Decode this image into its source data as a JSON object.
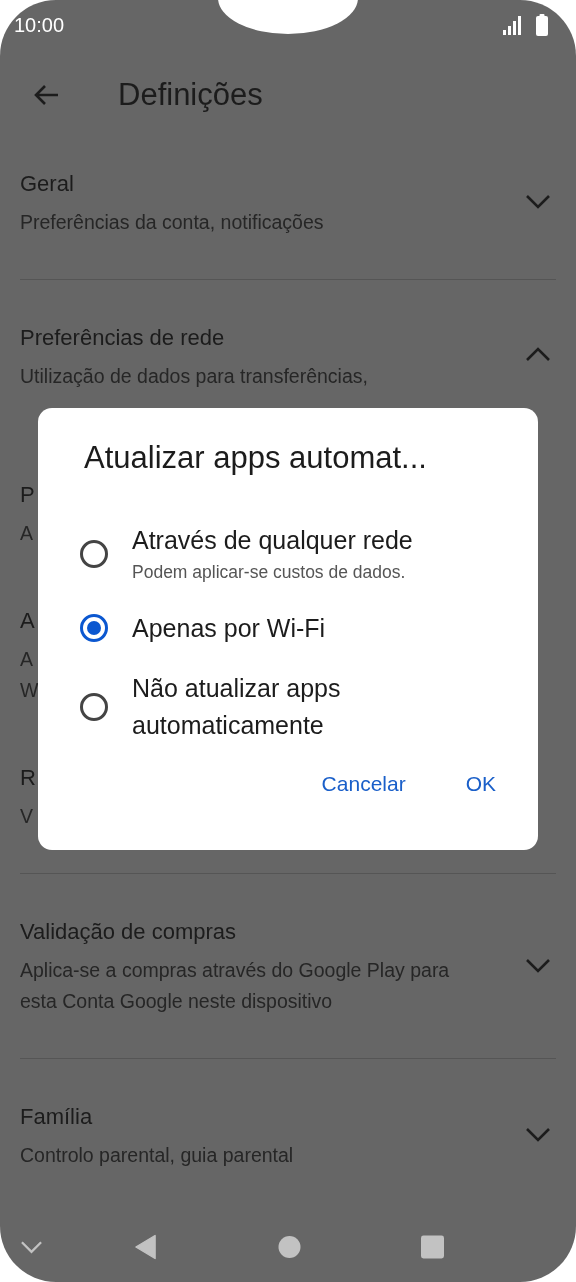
{
  "status_bar": {
    "time": "10:00"
  },
  "header": {
    "title": "Definições"
  },
  "groups": [
    {
      "items": [
        {
          "title": "Geral",
          "subtitle": "Preferências da conta, notificações",
          "expanded": false
        }
      ]
    },
    {
      "items": [
        {
          "title": "Preferências de rede",
          "subtitle": "Utilização de dados para transferências,",
          "expanded": true
        },
        {
          "title": "P",
          "subtitle": "A"
        },
        {
          "title": "A",
          "subtitle": "A\nW"
        },
        {
          "title": "R",
          "subtitle": "V"
        }
      ]
    },
    {
      "items": [
        {
          "title": "Validação de compras",
          "subtitle": "Aplica-se a compras através do Google Play para\nesta Conta Google neste dispositivo",
          "expanded": false
        }
      ]
    },
    {
      "items": [
        {
          "title": "Família",
          "subtitle": "Controlo parental, guia parental",
          "expanded": false
        }
      ]
    }
  ],
  "dialog": {
    "title": "Atualizar apps automat...",
    "options": [
      {
        "label": "Através de qualquer rede",
        "description": "Podem aplicar-se custos de dados.",
        "selected": false
      },
      {
        "label": "Apenas por Wi-Fi",
        "selected": true
      },
      {
        "label": "Não atualizar apps\nautomaticamente",
        "selected": false
      }
    ],
    "buttons": [
      "Cancelar",
      "OK"
    ]
  }
}
